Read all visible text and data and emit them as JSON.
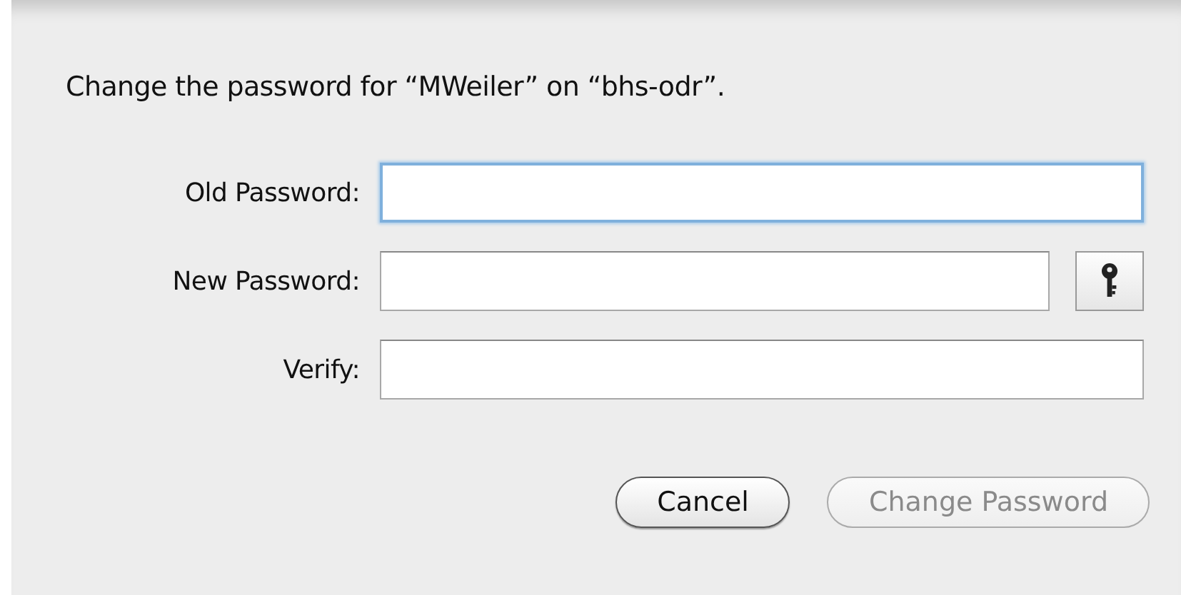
{
  "sheet": {
    "message": "Change the password for “MWeiler” on “bhs-odr”."
  },
  "fields": [
    {
      "label": "Old Password:",
      "focused": true,
      "generator": false
    },
    {
      "label": "New Password:",
      "focused": false,
      "generator": true
    },
    {
      "label": "Verify:",
      "focused": false,
      "generator": false
    }
  ],
  "buttons": [
    {
      "label": "Cancel",
      "disabled": false
    },
    {
      "label": "Change Password",
      "disabled": true
    }
  ]
}
